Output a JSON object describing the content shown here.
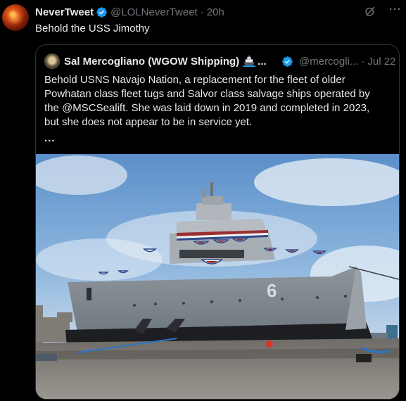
{
  "tweet": {
    "author_name": "NeverTweet",
    "author_handle": "@LOLNeverTweet",
    "separator": "·",
    "time": "20h",
    "text": "Behold the USS Jimothy",
    "more_label": "···"
  },
  "quoted_tweet": {
    "author_name": "Sal Mercogliano (WGOW Shipping)",
    "name_ellipsis": "...",
    "author_handle": "@mercogli...",
    "separator": "·",
    "date": "Jul 22",
    "text_lines": [
      "Behold USNS Navajo Nation, a replacement for the fleet of older",
      "Powhatan class fleet tugs and Salvor class salvage ships operated by",
      "the @MSCSealift. She was laid down in 2019 and completed in 2023,",
      "but she does not appear to be in service yet."
    ],
    "truncation": "...",
    "hull_number": "6"
  },
  "icons": {
    "verified": "verified-badge-icon",
    "grok": "grok-icon",
    "more": "more-options-icon",
    "ship_emoji": "ship-emoji-icon"
  },
  "colors": {
    "background": "#000000",
    "text": "#e7e9ea",
    "muted": "#71767b",
    "verified": "#1d9bf0",
    "border": "#2f3336"
  }
}
